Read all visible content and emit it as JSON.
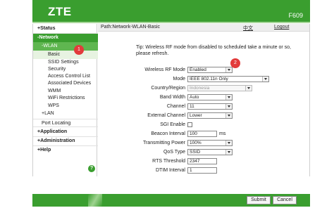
{
  "header": {
    "logo": "ZTE",
    "model": "F609"
  },
  "sidebar": {
    "status": "+Status",
    "network": "-Network",
    "wlan": "-WLAN",
    "wlan_items": [
      "Basic",
      "SSID Settings",
      "Security",
      "Access Control List",
      "Associated Devices",
      "WMM",
      "WiFi Restrictions",
      "WPS"
    ],
    "lan": "+LAN",
    "port_locating": "Port Locating",
    "application": "+Application",
    "administration": "+Administration",
    "help": "+Help",
    "help_badge": "?"
  },
  "pathbar": {
    "path": "Path:Network-WLAN-Basic",
    "lang": "中文",
    "logout": "Logout"
  },
  "tip": "Tip: Wireless RF mode from disabled to scheduled take a minute or so, please refresh.",
  "form": {
    "wireless_rf_mode": {
      "label": "Wireless RF Mode",
      "value": "Enabled"
    },
    "mode": {
      "label": "Mode",
      "value": "IEEE 802.11n Only"
    },
    "country": {
      "label": "Country/Region",
      "value": "Indonesia"
    },
    "band_width": {
      "label": "Band Width",
      "value": "Auto"
    },
    "channel": {
      "label": "Channel",
      "value": "11"
    },
    "external_channel": {
      "label": "External Channel",
      "value": "Lower"
    },
    "sgi_enable": {
      "label": "SGI Enable",
      "checked": false
    },
    "beacon_interval": {
      "label": "Beacon Interval",
      "value": "100",
      "unit": "ms"
    },
    "transmitting_power": {
      "label": "Transmitting Power",
      "value": "100%"
    },
    "qos_type": {
      "label": "QoS Type",
      "value": "SSID"
    },
    "rts_threshold": {
      "label": "RTS Threshold",
      "value": "2347"
    },
    "dtim_interval": {
      "label": "DTIM Interval",
      "value": "1"
    }
  },
  "annotations": {
    "badge1": "1",
    "badge2": "2"
  },
  "buttons": {
    "submit": "Submit",
    "cancel": "Cancel"
  },
  "colors": {
    "brand_green": "#3a9e2f",
    "badge_red": "#e23b3b"
  }
}
